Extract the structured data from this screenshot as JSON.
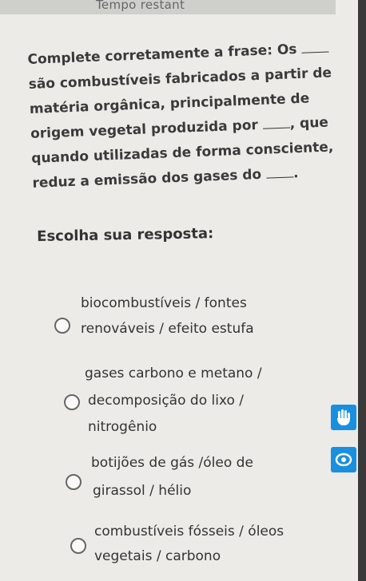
{
  "header": {
    "timer_label": "Tempo restant"
  },
  "question": {
    "part1": "Complete corretamente a frase: Os",
    "part2": "são combustíveis fabricados a partir de matéria orgânica, principalmente de origem vegetal produzida por",
    "part3": ", que quando utilizadas de forma consciente, reduz a emissão dos gases do",
    "part4": "."
  },
  "prompt": "Escolha sua resposta:",
  "options": [
    {
      "line1": "biocombustíveis / fontes",
      "line2": "renováveis / efeito estufa"
    },
    {
      "line1": "gases carbono e metano /",
      "line2": "decomposição do lixo /",
      "line3": "nitrogênio"
    },
    {
      "line1": "botijões de gás /óleo de",
      "line2": "girassol / hélio"
    },
    {
      "line1": "combustíveis fósseis / óleos",
      "line2": "vegetais / carbono"
    }
  ],
  "side_tools": [
    {
      "icon": "hand-icon",
      "color": "#1a8fe0"
    },
    {
      "icon": "eye-icon",
      "color": "#1a8fe0"
    }
  ]
}
